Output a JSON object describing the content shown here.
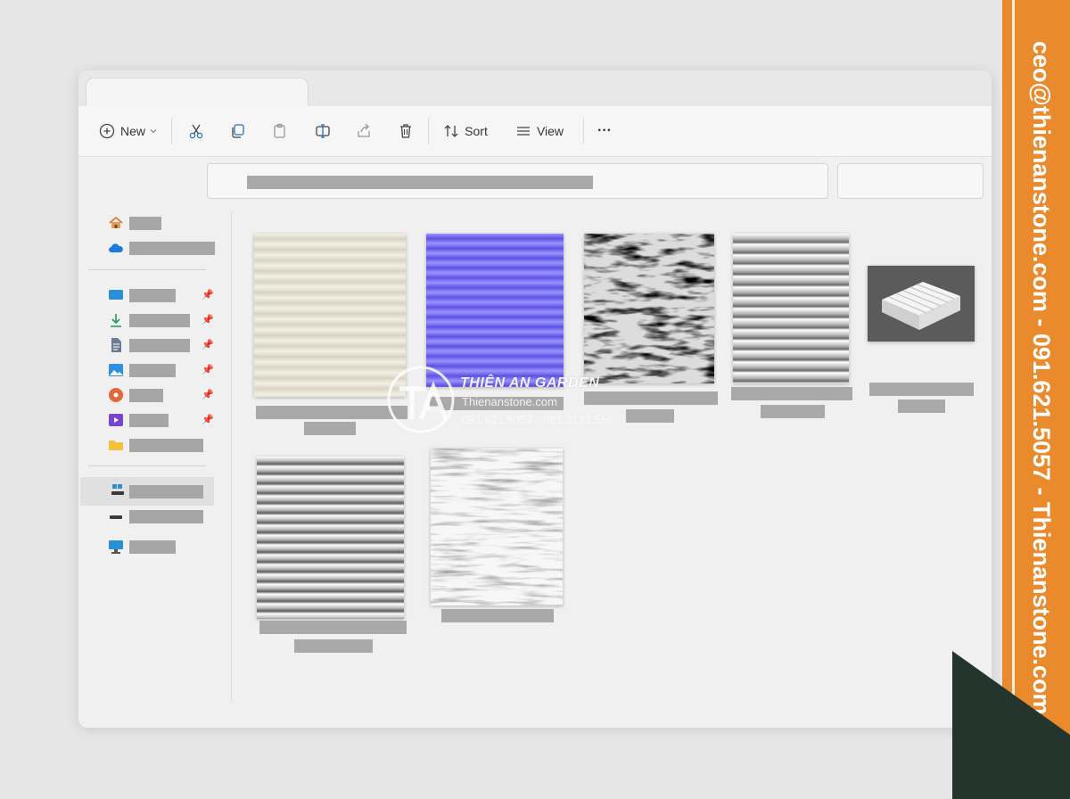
{
  "toolbar": {
    "new_label": "New",
    "sort_label": "Sort",
    "view_label": "View",
    "more_label": "···",
    "icons": [
      "plus-circle-icon",
      "chevron-down-icon",
      "cut-icon",
      "copy-icon",
      "paste-icon",
      "rename-icon",
      "share-icon",
      "delete-icon",
      "sort-icon",
      "view-icon",
      "more-icon"
    ]
  },
  "sidebar": {
    "icons": [
      "home-icon",
      "cloud-icon",
      "desktop-icon",
      "download-icon",
      "documents-icon",
      "pictures-icon",
      "music-icon",
      "videos-icon",
      "folder-icon",
      "windows-drive-icon",
      "drive-icon",
      "network-icon"
    ]
  },
  "watermark": {
    "brand": "THIÊN AN GARDEN",
    "site": "Thienanstone.com",
    "phones": "091.621.5057 - 081.3131.555"
  },
  "banner": {
    "text": "ceo@thienanstone.com - 091.621.5057 - Thienanstone.com"
  },
  "colors": {
    "accent_orange": "#e98a2d",
    "dark_green": "#24352e",
    "normal_map_blue": "#7a74ef"
  }
}
